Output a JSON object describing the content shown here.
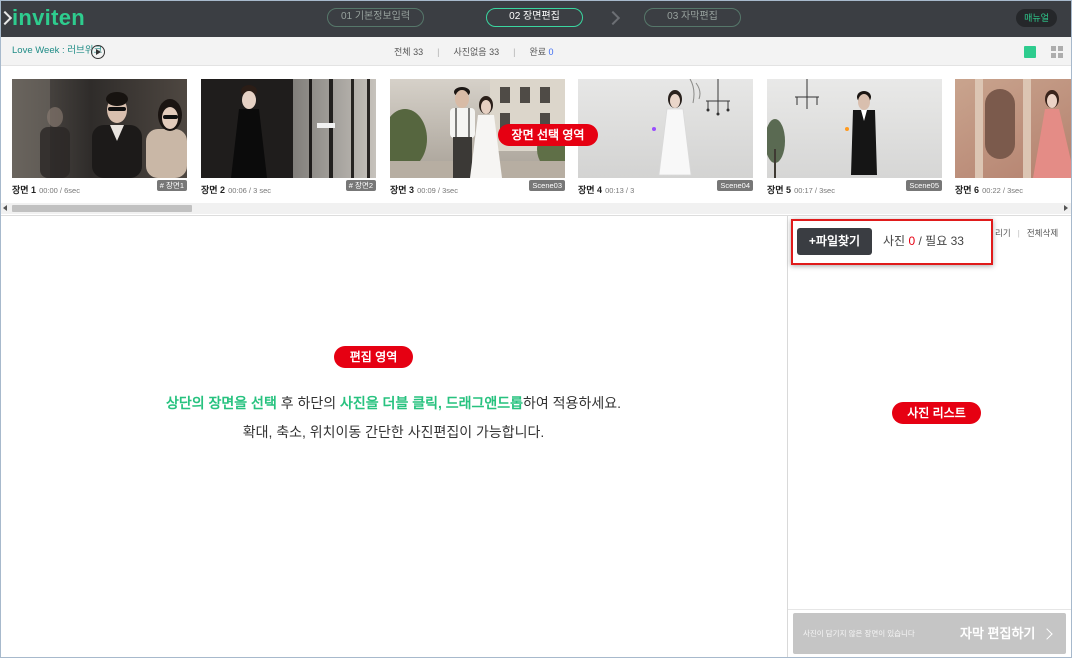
{
  "brand": {
    "logo": "inviten"
  },
  "steps": [
    {
      "label": "01 기본정보입력",
      "active": false
    },
    {
      "label": "02 장면편집",
      "active": true
    },
    {
      "label": "03 자막편집",
      "active": false
    }
  ],
  "header": {
    "manual_button": "매뉴얼",
    "step_separator_icon": "chevron-right-icon"
  },
  "project": {
    "title": "Love Week : 러브위크",
    "play_icon": "play-circle-icon"
  },
  "stats": {
    "total_label": "전체",
    "total_value": "33",
    "empty_label": "사진없음",
    "empty_value": "33",
    "done_label": "완료",
    "done_value": "0",
    "separator": "|"
  },
  "view_toggle": {
    "single_icon": "single-view-icon",
    "grid_icon": "grid-view-icon"
  },
  "scenes": [
    {
      "name": "장면 1",
      "time": "00:00 / 6sec",
      "tag": "# 장면1"
    },
    {
      "name": "장면 2",
      "time": "00:06 / 3 sec",
      "tag": "# 장면2"
    },
    {
      "name": "장면 3",
      "time": "00:09 / 3sec",
      "tag": "Scene03"
    },
    {
      "name": "장면 4",
      "time": "00:13 / 3",
      "tag": "Scene04"
    },
    {
      "name": "장면 5",
      "time": "00:17 / 3sec",
      "tag": "Scene05"
    },
    {
      "name": "장면 6",
      "time": "00:22 / 3sec"
    }
  ],
  "annotations": {
    "scene_area": "장면 선택 영역",
    "edit_area": "편집 영역",
    "photo_list": "사진 리스트"
  },
  "editor": {
    "line1": [
      "상단의 장면을 선택",
      " 후 하단의 ",
      "사진을 더블 클릭, 드래그앤드롭",
      "하여 적용하세요."
    ],
    "line1_highlight": [
      true,
      false,
      true,
      false
    ],
    "line2": "확대, 축소, 위치이동 간단한 사진편집이 가능합니다."
  },
  "photo_panel": {
    "find_file_button": "+파일찾기",
    "photo_label": "사진",
    "photo_count": "0",
    "separator": "/",
    "required_label": "필요",
    "required_count": "33",
    "hide_action_partial": "리기",
    "action_separator": "|",
    "delete_all_action": "전체삭제"
  },
  "footer": {
    "notice": "사진이 담기지 않은 장면이 있습니다",
    "next_button": "자막 편집하기",
    "next_icon": "chevron-right-icon"
  },
  "colors": {
    "accent": "#2ecc8e",
    "topbar": "#3b3e43",
    "annotation": "#e60012",
    "photo_count": "#e60012",
    "done_count": "#3d6cf2",
    "highlight_text": "#27c27f"
  }
}
